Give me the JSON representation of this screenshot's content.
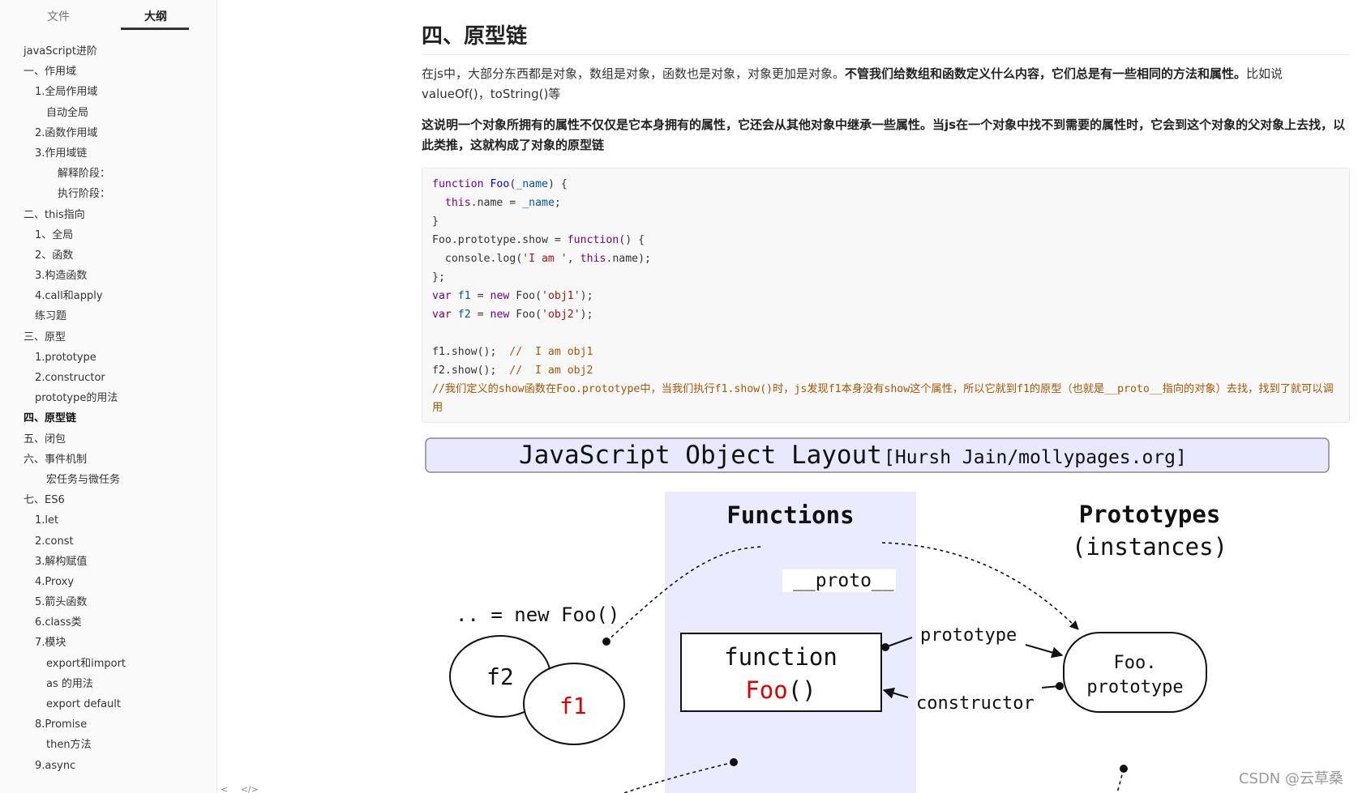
{
  "sidebar": {
    "tabs": [
      {
        "label": "文件",
        "active": false
      },
      {
        "label": "大纲",
        "active": true
      }
    ],
    "outline": [
      {
        "label": "javaScript进阶",
        "level": 0
      },
      {
        "label": "一、作用域",
        "level": 0
      },
      {
        "label": "1.全局作用域",
        "level": 1
      },
      {
        "label": "自动全局",
        "level": 2
      },
      {
        "label": "2.函数作用域",
        "level": 1
      },
      {
        "label": "3.作用域链",
        "level": 1
      },
      {
        "label": "解释阶段：",
        "level": 3
      },
      {
        "label": "执行阶段：",
        "level": 3
      },
      {
        "label": "二、this指向",
        "level": 0
      },
      {
        "label": "1、全局",
        "level": 1
      },
      {
        "label": "2、函数",
        "level": 1
      },
      {
        "label": "3.构造函数",
        "level": 1
      },
      {
        "label": "4.call和apply",
        "level": 1
      },
      {
        "label": "练习题",
        "level": 1
      },
      {
        "label": "三、原型",
        "level": 0
      },
      {
        "label": "1.prototype",
        "level": 1
      },
      {
        "label": "2.constructor",
        "level": 1
      },
      {
        "label": "prototype的用法",
        "level": 1
      },
      {
        "label": "四、原型链",
        "level": 0,
        "active": true
      },
      {
        "label": "五、闭包",
        "level": 0
      },
      {
        "label": "六、事件机制",
        "level": 0
      },
      {
        "label": "宏任务与微任务",
        "level": 2
      },
      {
        "label": "七、ES6",
        "level": 0
      },
      {
        "label": "1.let",
        "level": 1
      },
      {
        "label": "2.const",
        "level": 1
      },
      {
        "label": "3.解构赋值",
        "level": 1
      },
      {
        "label": "4.Proxy",
        "level": 1
      },
      {
        "label": "5.箭头函数",
        "level": 1
      },
      {
        "label": "6.class类",
        "level": 1
      },
      {
        "label": "7.模块",
        "level": 1
      },
      {
        "label": "export和import",
        "level": 2
      },
      {
        "label": "as 的用法",
        "level": 2
      },
      {
        "label": "export default",
        "level": 2
      },
      {
        "label": "8.Promise",
        "level": 1
      },
      {
        "label": "then方法",
        "level": 2
      },
      {
        "label": "9.async",
        "level": 1
      }
    ],
    "footer_icons": [
      "<",
      "</>"
    ]
  },
  "main": {
    "heading": "四、原型链",
    "para1_normal": "在js中，大部分东西都是对象，数组是对象，函数也是对象，对象更加是对象。",
    "para1_bold": "不管我们给数组和函数定义什么内容，它们总是有一些相同的方法和属性。",
    "para1_tail": "比如说valueOf()，toString()等",
    "para2": "这说明一个对象所拥有的属性不仅仅是它本身拥有的属性，它还会从其他对象中继承一些属性。当js在一个对象中找不到需要的属性时，它会到这个对象的父对象上去找，以此类推，这就构成了对象的原型链",
    "code_comment": "//我们定义的show函数在Foo.prototype中，当我们执行f1.show()时，js发现f1本身没有show这个属性，所以它就到f1的原型（也就是__proto__指向的对象）去找，找到了就可以调用"
  },
  "diagram": {
    "title": "JavaScript Object Layout",
    "credit": "[Hursh Jain/mollypages.org]",
    "col_functions": "Functions",
    "col_prototypes_1": "Prototypes",
    "col_prototypes_2": "(instances)",
    "proto_label": "__proto__",
    "new_foo": ".. = new Foo()",
    "f2": "f2",
    "f1": "f1",
    "function_kw": "function",
    "foo_call": "Foo",
    "parens": "()",
    "prototype_label": "prototype",
    "constructor_label": "constructor",
    "foo_proto_1": "Foo.",
    "foo_proto_2": "prototype",
    "colors": {
      "functions_bg": "#ebebff",
      "title_bg": "#e8e8ff",
      "accent_red": "#e00000"
    }
  },
  "watermark": "CSDN @云草桑"
}
